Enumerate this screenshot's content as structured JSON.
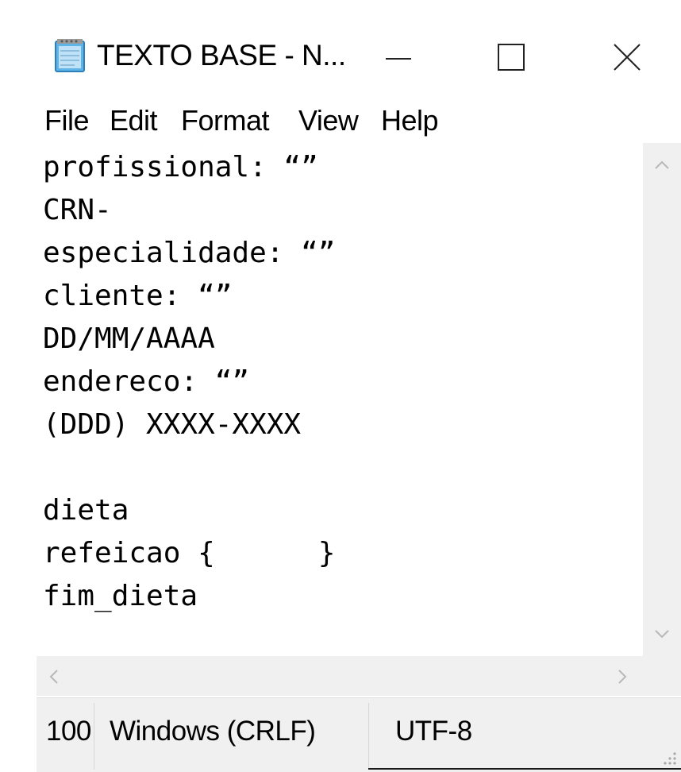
{
  "window": {
    "title": "TEXTO BASE - N...",
    "icons": {
      "app": "notepad-icon",
      "minimize": "minimize-icon",
      "maximize": "maximize-icon",
      "close": "close-icon"
    }
  },
  "menu": {
    "file": "File",
    "edit": "Edit",
    "format": "Format",
    "view": "View",
    "help": "Help"
  },
  "editor": {
    "content": "profissional: “”\nCRN-\nespecialidade: “”\ncliente: “”\nDD/MM/AAAA\nendereco: “”\n(DDD) XXXX-XXXX\n\ndieta\nrefeicao {      }\nfim_dieta"
  },
  "statusbar": {
    "zoom": "100",
    "line_ending": "Windows (CRLF)",
    "encoding": "UTF-8"
  },
  "colors": {
    "chrome_background": "#f0f0f0",
    "editor_background": "#ffffff",
    "text": "#000000"
  }
}
